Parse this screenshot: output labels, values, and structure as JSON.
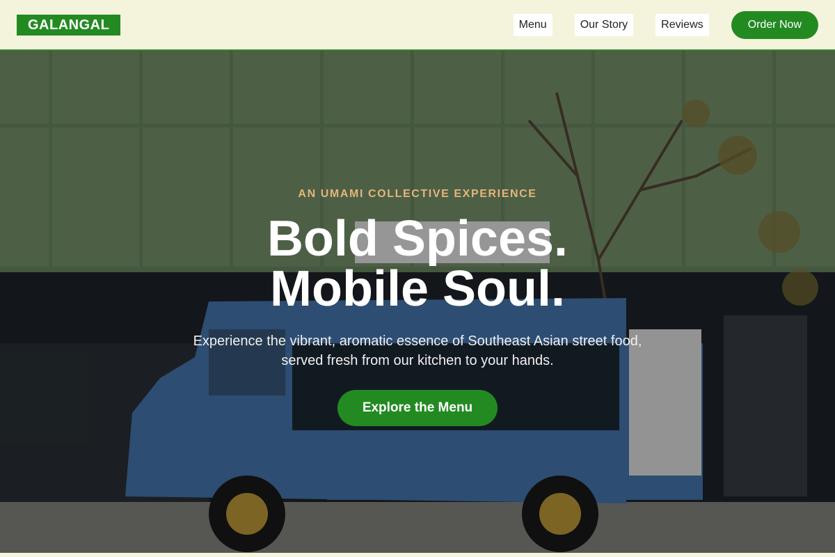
{
  "header": {
    "logo": "GALANGAL",
    "nav": [
      {
        "label": "Menu"
      },
      {
        "label": "Our Story"
      },
      {
        "label": "Reviews"
      }
    ],
    "order_label": "Order Now"
  },
  "hero": {
    "eyebrow": "AN UMAMI COLLECTIVE EXPERIENCE",
    "headline_line1": "Bold Spices.",
    "headline_line2": "Mobile Soul.",
    "subtext": "Experience the vibrant, aromatic essence of Southeast Asian street food, served fresh from our kitchen to your hands.",
    "cta_label": "Explore the Menu"
  },
  "colors": {
    "brand_green": "#238a22",
    "cream": "#f4f4dc",
    "eyebrow": "#e6b47a"
  }
}
